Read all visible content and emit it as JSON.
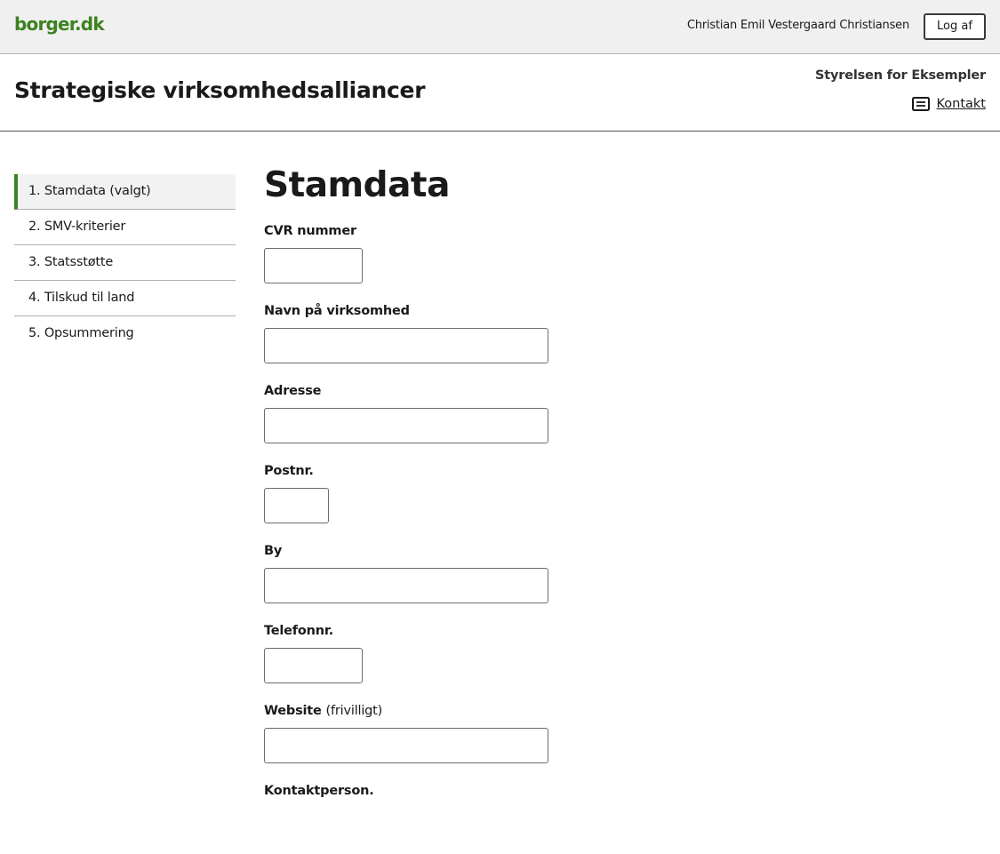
{
  "topbar": {
    "logo": "borger.dk",
    "user_name": "Christian Emil Vestergaard Christiansen",
    "logout_label": "Log af"
  },
  "header": {
    "title": "Strategiske virksomhedsalliancer",
    "authority": "Styrelsen for Eksempler",
    "contact_label": "Kontakt",
    "contact_icon": "message-icon"
  },
  "steps": [
    {
      "label": "1. Stamdata (valgt)",
      "active": true
    },
    {
      "label": "2. SMV-kriterier",
      "active": false
    },
    {
      "label": "3. Statsstøtte",
      "active": false
    },
    {
      "label": "4. Tilskud til land",
      "active": false
    },
    {
      "label": "5. Opsummering",
      "active": false
    }
  ],
  "form": {
    "title": "Stamdata",
    "fields": [
      {
        "label": "CVR nummer",
        "value": ""
      },
      {
        "label": "Navn på virksomhed",
        "value": ""
      },
      {
        "label": "Adresse",
        "value": ""
      },
      {
        "label": "Postnr.",
        "value": ""
      },
      {
        "label": "By",
        "value": ""
      },
      {
        "label": "Telefonnr.",
        "value": ""
      },
      {
        "label": "Website",
        "optional": "(frivilligt)",
        "value": ""
      },
      {
        "label": "Kontaktperson.",
        "value": ""
      }
    ]
  },
  "colors": {
    "brand_green": "#3c8320",
    "topbar_bg": "#f0f0f0",
    "active_step_bg": "#f2f2f2"
  }
}
